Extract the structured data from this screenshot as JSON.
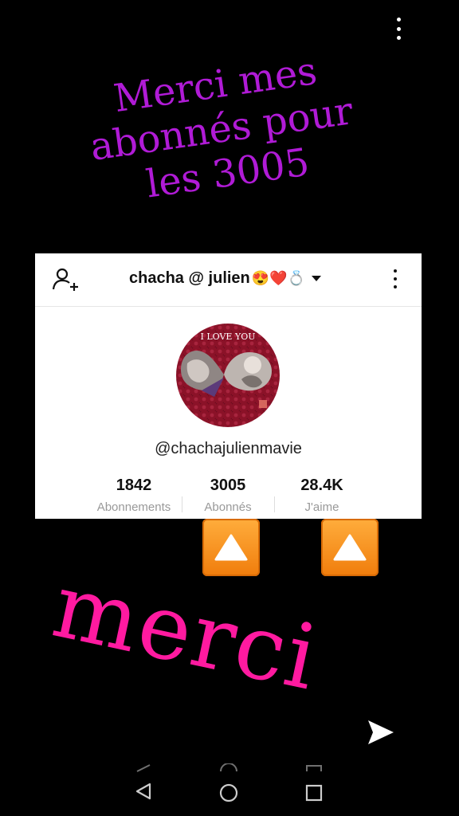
{
  "overlay": {
    "headline_lines": [
      "Merci mes",
      "abonnés pour",
      "les 3005"
    ],
    "bottom_text": "merci"
  },
  "profile": {
    "title_name": "chacha @ julien",
    "title_emojis": "😍❤️💍",
    "avatar_text": "I LOVE YOU",
    "handle": "@chachajulienmavie",
    "stats": [
      {
        "value": "1842",
        "label": "Abonnements"
      },
      {
        "value": "3005",
        "label": "Abonnés"
      },
      {
        "value": "28.4K",
        "label": "J'aime"
      }
    ]
  },
  "colors": {
    "headline": "#b01bd6",
    "merci": "#ff1aa0",
    "arrow_button": "#f5901c",
    "avatar_bg": "#8b1228"
  },
  "icons": [
    "kebab-menu-icon",
    "add-user-icon",
    "caret-down-icon",
    "up-arrow-icon",
    "send-icon",
    "back-icon",
    "home-icon",
    "recents-icon"
  ]
}
